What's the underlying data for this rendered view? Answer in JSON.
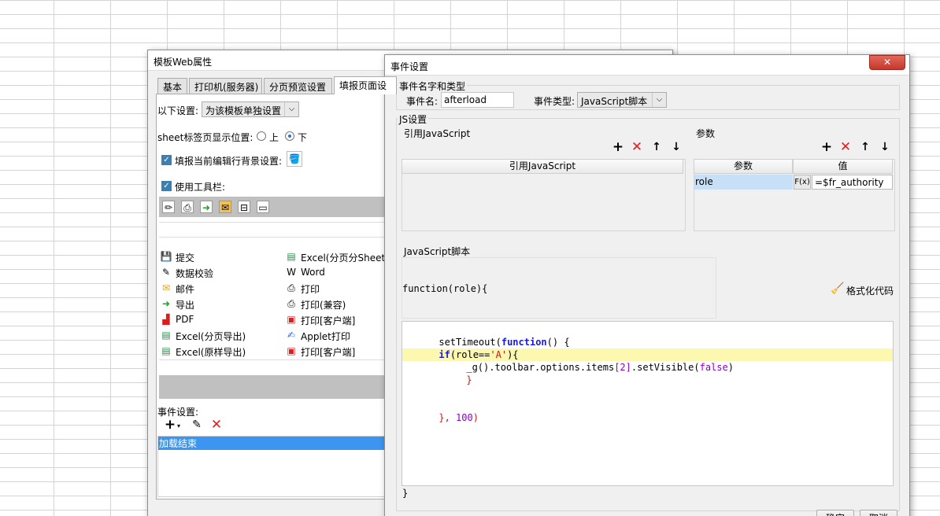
{
  "template_window": {
    "title": "模板Web属性",
    "tabs": [
      "基本",
      "打印机(服务器)",
      "分页预览设置",
      "填报页面设"
    ],
    "settings_label": "以下设置:",
    "settings_value": "为该模板单独设置",
    "sheet_pos_label": "sheet标签页显示位置:",
    "pos_top": "上",
    "pos_bottom": "下",
    "bg_label": "填报当前编辑行背景设置:",
    "toolbar_label": "使用工具栏:",
    "left_items": [
      "提交",
      "数据校验",
      "邮件",
      "导出",
      "PDF",
      "Excel(分页导出)",
      "Excel(原样导出)"
    ],
    "right_items": [
      "Excel(分页分Sheet导",
      "Word",
      "打印",
      "打印(兼容)",
      "打印[客户端]",
      "Applet打印",
      "打印[客户端]"
    ],
    "event_label": "事件设置:",
    "event_item": "加载结束"
  },
  "event_dialog": {
    "title": "事件设置",
    "close": "✕",
    "name_group": "事件名字和类型",
    "name_label": "事件名:",
    "name_value": "afterload",
    "type_label": "事件类型:",
    "type_value": "JavaScript脚本",
    "js_group": "JS设置",
    "ref_group": "引用JavaScript",
    "ref_header": "引用JavaScript",
    "param_group": "参数",
    "param_col1": "参数",
    "param_col2": "值",
    "param_name": "role",
    "param_fx": "F(x)",
    "param_value": "=$fr_authority",
    "script_group": "JavaScript脚本",
    "func_sig": "function(role){",
    "format_btn": "格式化代码",
    "closing_brace": "}",
    "ok_btn": "确定",
    "cancel_btn": "取消"
  },
  "code": {
    "l1_a": "setTimeout(",
    "l1_kw": "function",
    "l1_b": "() {",
    "l2_kw": "if",
    "l2_a": "(role==",
    "l2_str": "'A'",
    "l2_b": "){",
    "l3_a": "_g().toolbar.options.items",
    "l3_b": "[2]",
    "l3_c": ".setVisible(",
    "l3_kw": "false",
    "l3_d": ")",
    "l4": "}",
    "l5_a": "}, ",
    "l5_num": "100",
    "l5_b": ")"
  },
  "colors": {
    "selection": "#3c95f0",
    "highlight_line": "#fcf8b0",
    "delete_red": "#e02020"
  }
}
